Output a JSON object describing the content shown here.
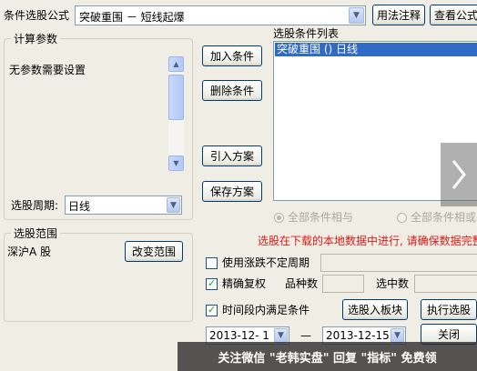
{
  "header": {
    "formula_label": "条件选股公式",
    "formula_value": "突破重围 － 短线起爆",
    "usage_button": "用法注释",
    "view_button": "查看公式"
  },
  "params_group": {
    "title": "计算参数",
    "text": "无参数需要设置"
  },
  "period": {
    "label": "选股周期:",
    "value": "日线"
  },
  "range_group": {
    "title": "选股范围",
    "value": "深沪A 股",
    "change_button": "改变范围"
  },
  "actions": {
    "add": "加入条件",
    "delete": "删除条件",
    "import": "引入方案",
    "save": "保存方案"
  },
  "conditions": {
    "title": "选股条件列表",
    "items": [
      "突破重围  ()  日线"
    ]
  },
  "logic": {
    "all_and": "全部条件相与",
    "all_or": "全部条件相或"
  },
  "notice": "选股在下载的本地数据中进行, 请确保数据完整",
  "options": {
    "uncertain_period": "使用涨跌不定周期",
    "precise_adjust": "精确复权",
    "variety_count_label": "品种数",
    "selected_count_label": "选中数",
    "time_range": "时间段内满足条件",
    "start_date": "2013-12- 1",
    "dash": "—",
    "end_date": "2013-12-15"
  },
  "buttons": {
    "to_block": "选股入板块",
    "execute": "执行选股",
    "close": "关闭"
  },
  "overlay": {
    "watermark": "关注微信 \"老韩实盘\" 回复 \"指标\" 免费领"
  },
  "colors": {
    "notice": "#e01818",
    "selection": "#316ac5",
    "dialog_bg": "#f0ede4"
  }
}
